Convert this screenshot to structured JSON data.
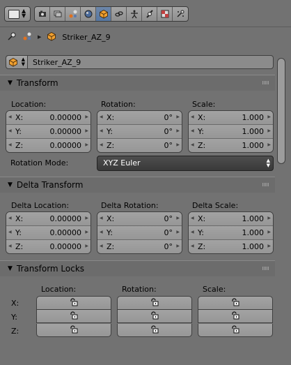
{
  "header": {
    "editor_type_icon": "properties-editor-icon",
    "context_tabs": [
      {
        "name": "render-icon",
        "active": false
      },
      {
        "name": "render-layers-icon",
        "active": false
      },
      {
        "name": "scene-icon",
        "active": false
      },
      {
        "name": "world-icon",
        "active": false
      },
      {
        "name": "object-icon",
        "active": true
      },
      {
        "name": "constraints-icon",
        "active": false
      },
      {
        "name": "modifiers-icon",
        "active": false
      },
      {
        "name": "physics-icon",
        "active": false
      },
      {
        "name": "texture-icon",
        "active": false
      },
      {
        "name": "particles-icon",
        "active": false
      }
    ]
  },
  "breadcrumb": {
    "object_name": "Striker_AZ_9"
  },
  "object_name_field": {
    "value": "Striker_AZ_9"
  },
  "transform": {
    "title": "Transform",
    "location": {
      "label": "Location:",
      "fields": [
        {
          "axis": "X:",
          "value": "0.00000"
        },
        {
          "axis": "Y:",
          "value": "0.00000"
        },
        {
          "axis": "Z:",
          "value": "0.00000"
        }
      ]
    },
    "rotation": {
      "label": "Rotation:",
      "fields": [
        {
          "axis": "X:",
          "value": "0°"
        },
        {
          "axis": "Y:",
          "value": "0°"
        },
        {
          "axis": "Z:",
          "value": "0°"
        }
      ]
    },
    "scale": {
      "label": "Scale:",
      "fields": [
        {
          "axis": "X:",
          "value": "1.000"
        },
        {
          "axis": "Y:",
          "value": "1.000"
        },
        {
          "axis": "Z:",
          "value": "1.000"
        }
      ]
    },
    "rotation_mode_label": "Rotation Mode:",
    "rotation_mode_value": "XYZ Euler"
  },
  "delta_transform": {
    "title": "Delta Transform",
    "location": {
      "label": "Delta Location:",
      "fields": [
        {
          "axis": "X:",
          "value": "0.00000"
        },
        {
          "axis": "Y:",
          "value": "0.00000"
        },
        {
          "axis": "Z:",
          "value": "0.00000"
        }
      ]
    },
    "rotation": {
      "label": "Delta Rotation:",
      "fields": [
        {
          "axis": "X:",
          "value": "0°"
        },
        {
          "axis": "Y:",
          "value": "0°"
        },
        {
          "axis": "Z:",
          "value": "0°"
        }
      ]
    },
    "scale": {
      "label": "Delta Scale:",
      "fields": [
        {
          "axis": "X:",
          "value": "1.000"
        },
        {
          "axis": "Y:",
          "value": "1.000"
        },
        {
          "axis": "Z:",
          "value": "1.000"
        }
      ]
    }
  },
  "transform_locks": {
    "title": "Transform Locks",
    "columns": [
      "Location:",
      "Rotation:",
      "Scale:"
    ],
    "rows": [
      "X:",
      "Y:",
      "Z:"
    ]
  },
  "colors": {
    "active_tab": "#5678a3",
    "panel_bg": "#727272",
    "object_orange": "#e8902a"
  }
}
